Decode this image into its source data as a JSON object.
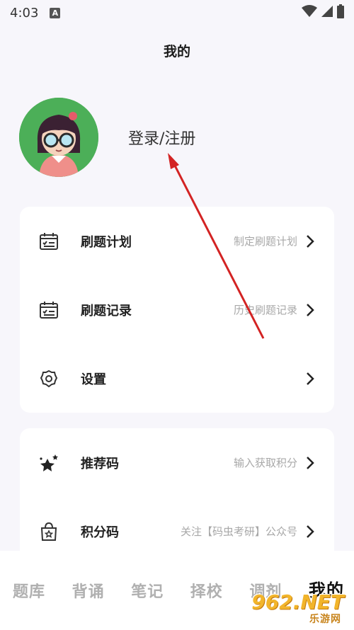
{
  "status": {
    "time": "4:03",
    "notif": "A"
  },
  "page": {
    "title": "我的"
  },
  "profile": {
    "login_text": "登录/注册"
  },
  "card1": {
    "rows": [
      {
        "label": "刷题计划",
        "hint": "制定刷题计划",
        "icon": "calendar-check-icon"
      },
      {
        "label": "刷题记录",
        "hint": "历史刷题记录",
        "icon": "calendar-list-icon"
      },
      {
        "label": "设置",
        "hint": "",
        "icon": "gear-icon"
      }
    ]
  },
  "card2": {
    "rows": [
      {
        "label": "推荐码",
        "hint": "输入获取积分",
        "icon": "stars-icon"
      },
      {
        "label": "积分码",
        "hint": "关注【码虫考研】公众号",
        "icon": "gift-bag-icon"
      }
    ]
  },
  "tabbar": {
    "tabs": [
      "题库",
      "背诵",
      "笔记",
      "择校",
      "调剂",
      "我的"
    ],
    "active": "我的"
  },
  "watermark": {
    "main": "962.NET",
    "sub": "乐游网"
  },
  "colors": {
    "avatar_bg": "#4caf58",
    "annotation_arrow": "#d32323",
    "background": "#f7f6fb"
  }
}
